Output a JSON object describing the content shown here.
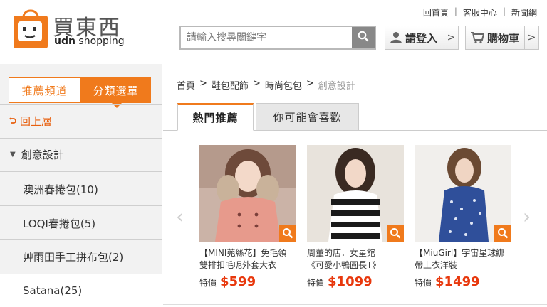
{
  "brand": {
    "name_cn": "買東西",
    "name_en_bold": "udn",
    "name_en_rest": " shopping"
  },
  "toplinks": [
    "回首頁",
    "客服中心",
    "新聞網"
  ],
  "search": {
    "placeholder": "請輸入搜尋關鍵字"
  },
  "header_buttons": {
    "login": "請登入",
    "cart": "購物車"
  },
  "sidebar": {
    "tabs": {
      "recommend": "推薦頻道",
      "category": "分類選單"
    },
    "back": "回上層",
    "current_category": "創意設計",
    "subcategories": [
      "澳洲春捲包(10)",
      "LOQI春捲包(5)",
      "艸雨田手工拼布包(2)",
      "Satana(25)"
    ]
  },
  "breadcrumb": [
    "首頁",
    "鞋包配飾",
    "時尚包包",
    "創意設計"
  ],
  "product_tabs": {
    "active": "熱門推薦",
    "inactive": "你可能會喜歡"
  },
  "products": [
    {
      "name_line1": "【MINI蔸絲花】免毛領",
      "name_line2": "雙排扣毛呢外套大衣",
      "price_label": "特價",
      "price": "$599"
    },
    {
      "name_line1": "周董的店．女星館",
      "name_line2": "《可愛小鴨圓長T》",
      "price_label": "特價",
      "price": "$1099"
    },
    {
      "name_line1": "【MiuGirl】宇宙星球綁",
      "name_line2": "帶上衣洋裝",
      "price_label": "特價",
      "price": "$1499"
    }
  ],
  "icons": {
    "search": "search-icon",
    "user": "user-icon",
    "cart": "cart-icon",
    "zoom": "zoom-icon"
  },
  "colors": {
    "accent": "#f07a1c",
    "price": "#e8380d"
  }
}
